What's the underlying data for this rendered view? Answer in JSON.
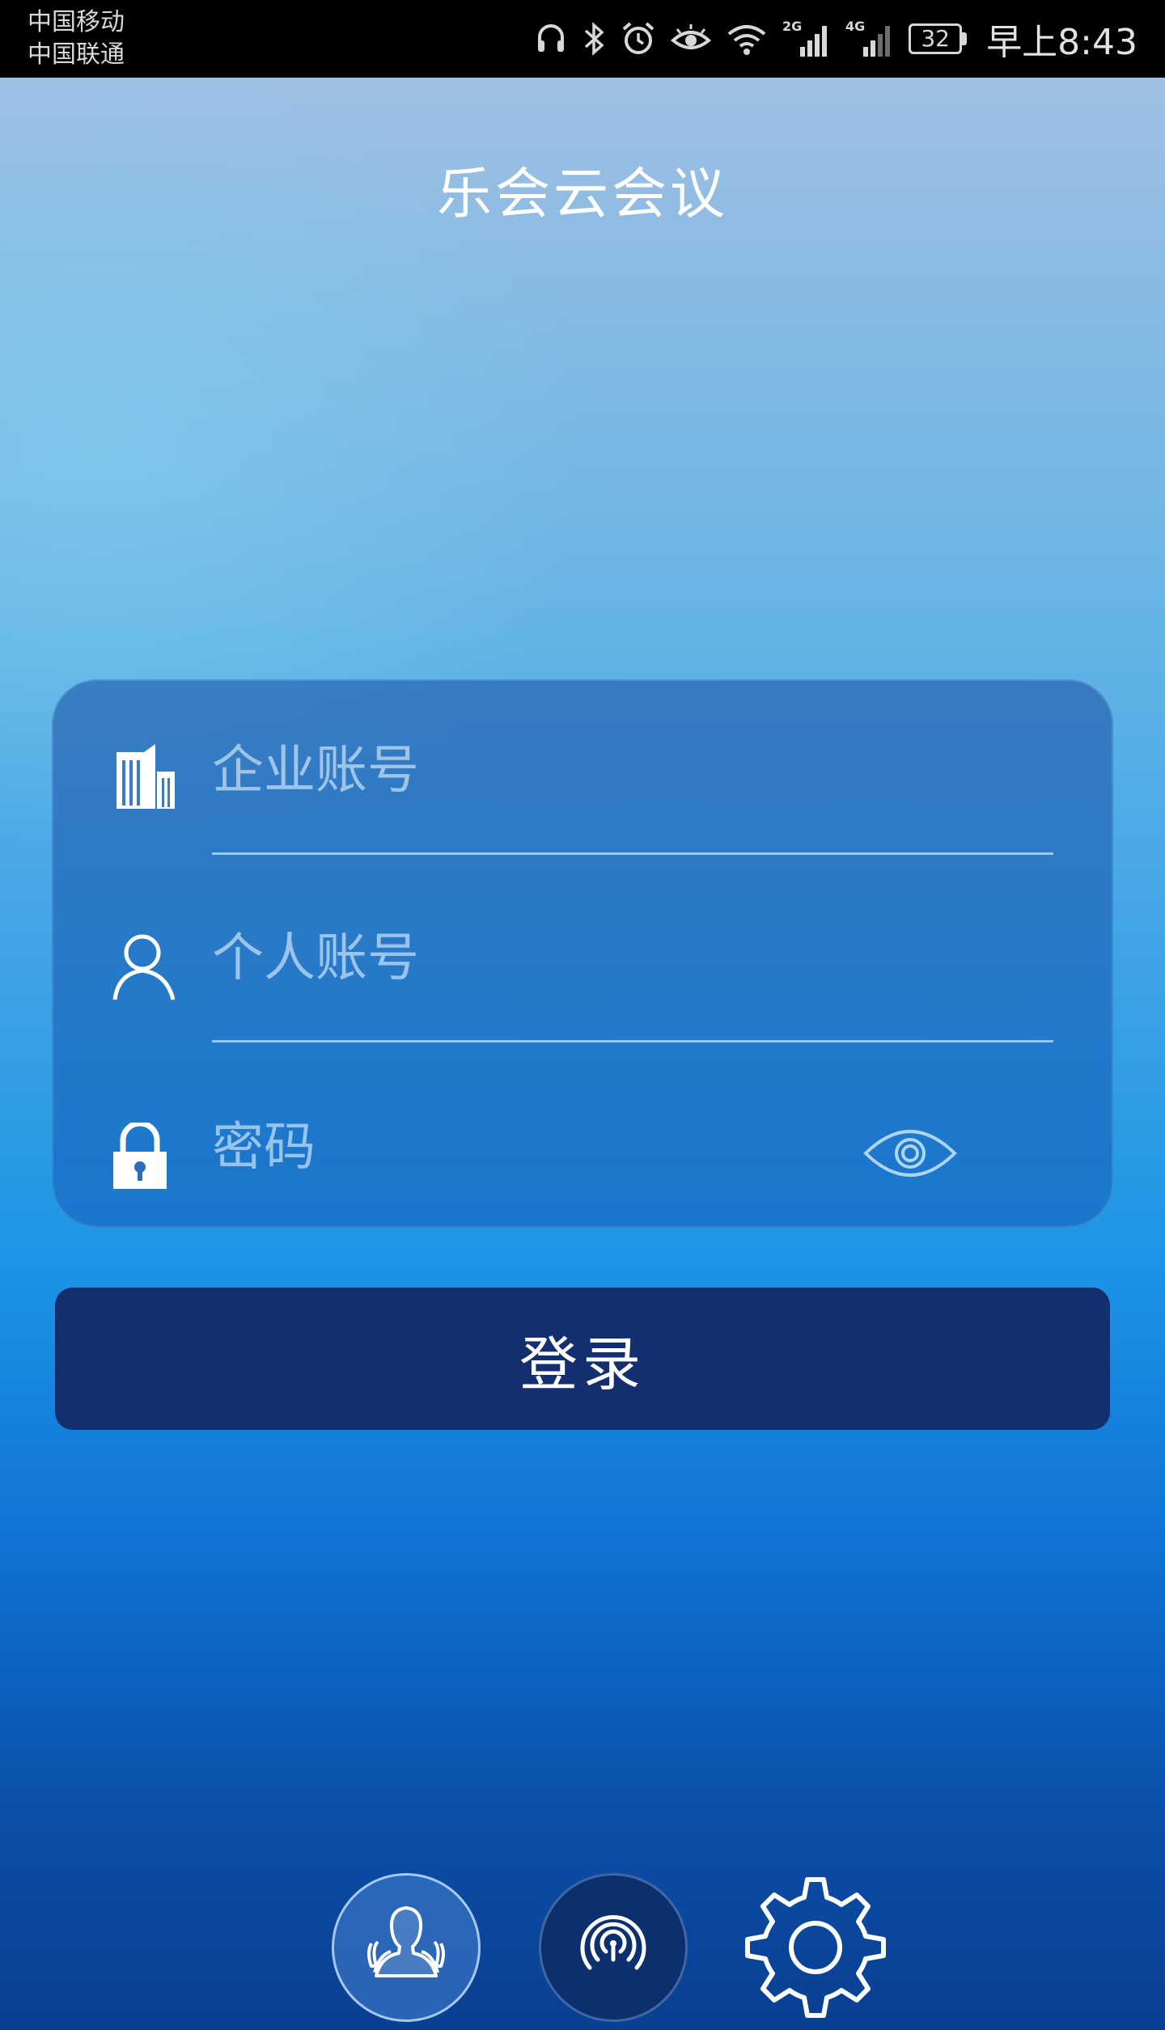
{
  "status_bar": {
    "carrier_1": "中国移动",
    "carrier_2": "中国联通",
    "network_1": "2G",
    "network_2": "4G",
    "battery_level": "32",
    "time": "早上8:43",
    "icons": [
      "headset-icon",
      "bluetooth-icon",
      "alarm-icon",
      "eye-comfort-icon",
      "wifi-icon",
      "signal-2g-icon",
      "signal-4g-icon",
      "battery-icon"
    ]
  },
  "app": {
    "title": "乐会云会议"
  },
  "login_form": {
    "enterprise_account": {
      "placeholder": "企业账号",
      "value": "",
      "icon": "building-icon"
    },
    "personal_account": {
      "placeholder": "个人账号",
      "value": "",
      "icon": "user-icon"
    },
    "password": {
      "placeholder": "密码",
      "value": "",
      "icon": "lock-icon",
      "toggle_icon": "eye-icon"
    },
    "submit_label": "登录"
  },
  "bottom_bar": {
    "items": [
      {
        "icon": "contacts-icon"
      },
      {
        "icon": "wireless-icon"
      },
      {
        "icon": "gear-icon"
      }
    ]
  },
  "colors": {
    "button": "#132f70",
    "background_top": "#a7c2e6",
    "background_bottom": "#0a3f91"
  }
}
